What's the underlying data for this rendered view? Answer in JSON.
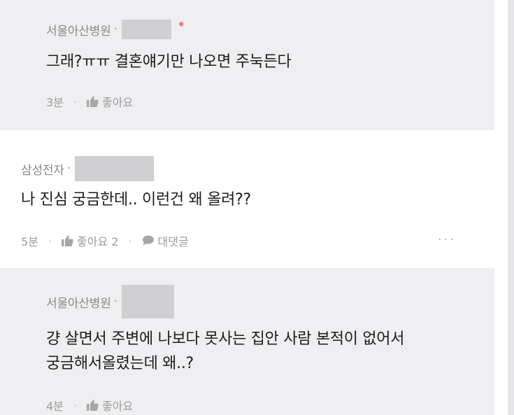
{
  "comments": [
    {
      "author": "서울아산병원",
      "separator": "·",
      "op_marker": "*",
      "text": "그래?ㅠㅠ 결혼얘기만 나오면 주눅든다",
      "time": "3분",
      "like_label": "좋아요"
    },
    {
      "author": "삼성전자",
      "separator": "·",
      "text": "나 진심 궁금한데.. 이런건 왜 올려??",
      "time": "5분",
      "like_label": "좋아요 2",
      "reply_label": "대댓글",
      "more": "···"
    },
    {
      "author": "서울아산병원",
      "separator": "·",
      "text_line1": "걍 살면서 주변에 나보다 못사는 집안 사람 본적이 없어서",
      "text_line2": "궁금해서올렸는데 왜..?",
      "time": "4분",
      "like_label": "좋아요"
    }
  ],
  "icons": {
    "like": "thumbs-up-icon",
    "reply": "speech-bubble-icon",
    "more": "more-horizontal-icon"
  },
  "colors": {
    "reply_background": "#efeff2",
    "main_background": "#ffffff",
    "op_star": "#e5322e",
    "meta_text": "#9c9c9c"
  }
}
